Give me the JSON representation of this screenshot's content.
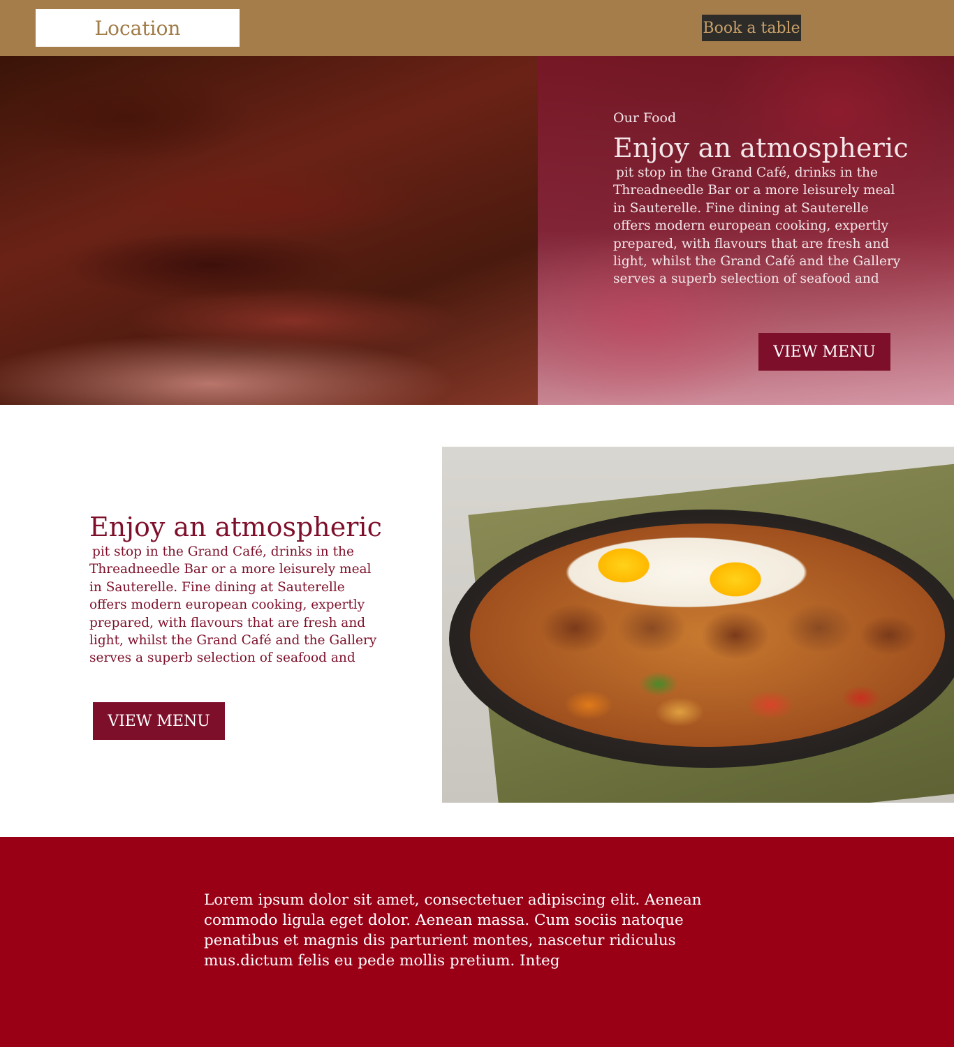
{
  "colors": {
    "header_bg": "#a57d4b",
    "location_text": "#a07b47",
    "book_button_bg": "#2d2c28",
    "book_button_text": "#c9a06a",
    "accent": "#7d0f2a",
    "hero_text": "#f3e7ea",
    "mid_text": "#7d0f2a",
    "button_text": "#ffffff",
    "footer_bg": "#990016",
    "footer_text": "#ffffff"
  },
  "header": {
    "location_label": "Location",
    "book_label": "Book a table"
  },
  "hero": {
    "kicker": "Our Food",
    "title": "Enjoy an atmospheric",
    "body": "pit stop in the Grand Café, drinks in the Threadneedle Bar or a more leisurely meal in Sauterelle. Fine dining at Sauterelle offers modern european cooking, expertly prepared, with flavours that are fresh and light, whilst the Grand Café and the Gallery serves a superb selection of seafood and",
    "button_label": "VIEW MENU"
  },
  "feature": {
    "title": "Enjoy an atmospheric",
    "body": "pit stop in the Grand Café, drinks in the Threadneedle Bar or a more leisurely meal in Sauterelle. Fine dining at Sauterelle offers modern european cooking, expertly prepared, with flavours that are fresh and light, whilst the Grand Café and the Gallery serves a superb selection of seafood and",
    "button_label": "VIEW MENU"
  },
  "footer": {
    "text": "Lorem ipsum dolor sit amet, consectetuer adipiscing elit. Aenean commodo ligula eget dolor. Aenean massa. Cum sociis natoque penatibus et magnis dis parturient montes, nascetur ridiculus mus.dictum felis eu pede mollis pretium. Integ"
  }
}
